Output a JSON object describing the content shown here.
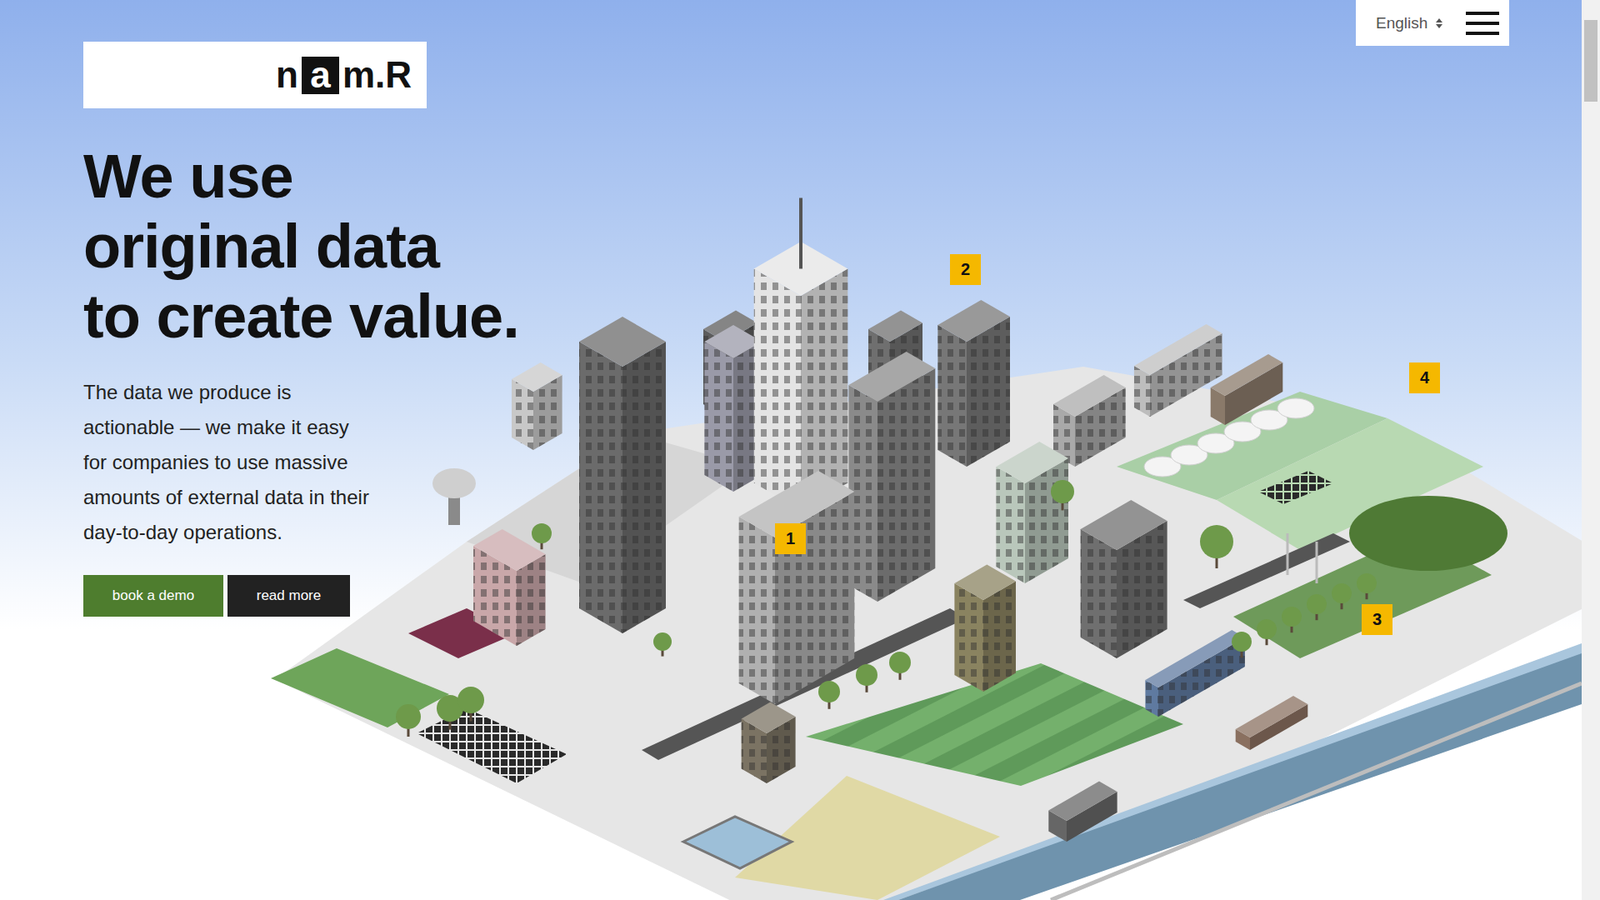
{
  "logo": {
    "before": "n",
    "highlight": "a",
    "after": "m.R"
  },
  "language": {
    "label": "English"
  },
  "hero": {
    "title_lines": [
      "We use",
      "original data",
      "to create value."
    ],
    "body": "The data we produce is actionable — we make it easy for companies to use massive amounts of external data in their day-to-day operations."
  },
  "buttons": [
    {
      "label": "book a demo",
      "kind": "primary"
    },
    {
      "label": "read more",
      "kind": "secondary"
    }
  ],
  "markers": [
    {
      "label": "1"
    },
    {
      "label": "2"
    },
    {
      "label": "3"
    },
    {
      "label": "4"
    }
  ]
}
